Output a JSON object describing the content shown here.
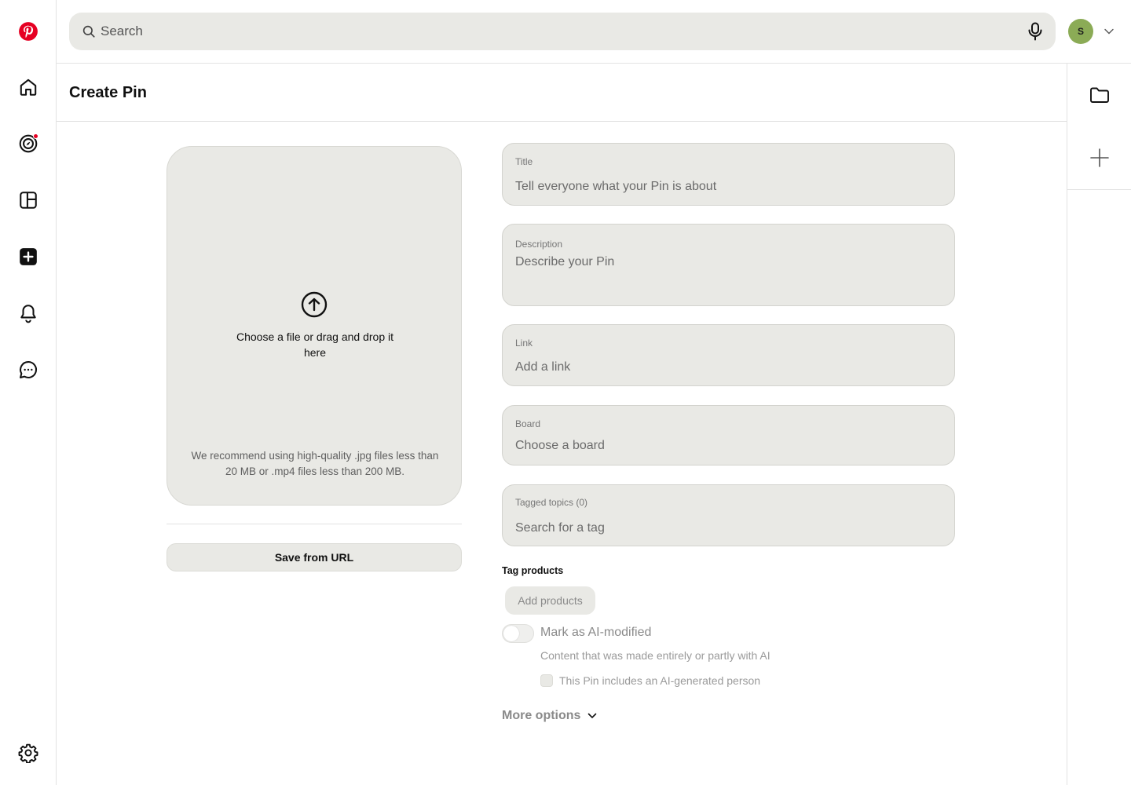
{
  "app": {
    "brand_color": "#e60023"
  },
  "nav": {
    "items": [
      {
        "name": "pinterest-logo",
        "icon": "pinterest-logo-icon"
      },
      {
        "name": "home",
        "icon": "home-icon"
      },
      {
        "name": "explore",
        "icon": "compass-icon",
        "notification": true
      },
      {
        "name": "boards",
        "icon": "boards-icon"
      },
      {
        "name": "create",
        "icon": "plus-square-icon"
      },
      {
        "name": "notifications",
        "icon": "bell-icon"
      },
      {
        "name": "messages",
        "icon": "chat-icon"
      },
      {
        "name": "settings",
        "icon": "gear-icon"
      }
    ]
  },
  "search": {
    "placeholder": "Search"
  },
  "account": {
    "initial": "S",
    "avatar_color": "#8bab56"
  },
  "page": {
    "title": "Create Pin"
  },
  "upload": {
    "prompt": "Choose a file or drag and drop it here",
    "hint": "We recommend using high-quality .jpg files less than 20 MB or .mp4 files less than 200 MB.",
    "save_from_url": "Save from URL"
  },
  "form": {
    "title": {
      "label": "Title",
      "placeholder": "Tell everyone what your Pin is about"
    },
    "description": {
      "label": "Description",
      "placeholder": "Describe your Pin"
    },
    "link": {
      "label": "Link",
      "placeholder": "Add a link"
    },
    "board": {
      "label": "Board",
      "value": "Choose a board"
    },
    "tagged_topics": {
      "label": "Tagged topics (0)",
      "placeholder": "Search for a tag"
    },
    "tag_products": {
      "label": "Tag products",
      "button": "Add products"
    },
    "ai": {
      "label": "Mark as AI-modified",
      "description": "Content that was made entirely or partly with AI",
      "checkbox_label": "This Pin includes an AI-generated person",
      "toggle_on": false,
      "checkbox_checked": false
    },
    "more_options": "More options"
  }
}
